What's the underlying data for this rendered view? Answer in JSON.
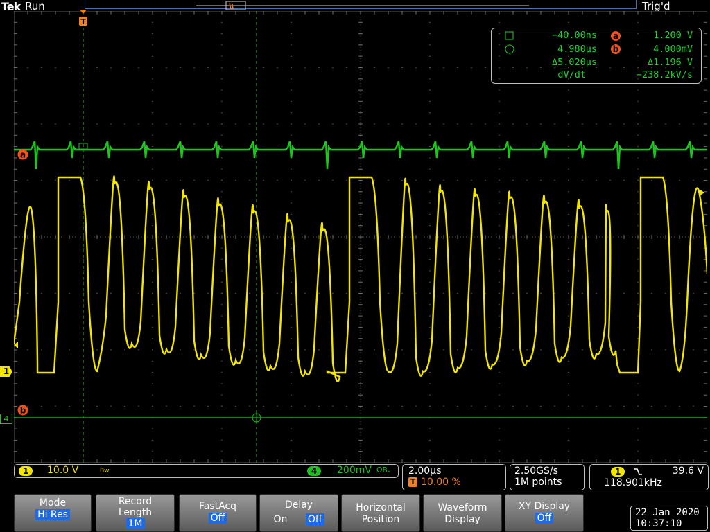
{
  "header": {
    "brand": "Tek",
    "state": "Run",
    "trigger_status": "Trig'd"
  },
  "cursor_readout": {
    "time_a": "−40.00ns",
    "time_b": "4.980µs",
    "delta_t": "Δ5.020µs",
    "dvdt_label": "dV/dt",
    "volt_a": "1.200 V",
    "volt_b": "4.000mV",
    "delta_v": "Δ1.196 V",
    "dvdt_value": "−238.2kV/s",
    "marker_a": "a",
    "marker_b": "b"
  },
  "channel1": {
    "label": "1",
    "scale": "10.0 V",
    "bw": "Bw",
    "color": "#f2e600"
  },
  "channel4": {
    "label": "4",
    "scale": "200mV",
    "coupling": "ΩBᵥ",
    "color": "#20c020"
  },
  "horizontal": {
    "time_per_div": "2.00µs",
    "trigger_pos": "10.00 %",
    "trigger_marker": "T"
  },
  "acquisition": {
    "sample_rate": "2.50GS/s",
    "record": "1M points"
  },
  "trigger": {
    "source": "1",
    "slope_icon": "falling-edge-icon",
    "level": "39.6 V",
    "frequency": "118.901kHz"
  },
  "softkeys": [
    {
      "title": "Mode",
      "value": "Hi Res"
    },
    {
      "title": "Record Length",
      "value": "1M"
    },
    {
      "title": "FastAcq",
      "value": "Off"
    },
    {
      "title": "Delay",
      "opt_on": "On",
      "opt_off": "Off"
    },
    {
      "title": "Horizontal Position",
      "value": ""
    },
    {
      "title": "Waveform Display",
      "value": ""
    },
    {
      "title": "XY Display",
      "value": "Off"
    }
  ],
  "datetime": {
    "date": "22 Jan 2020",
    "time": "10:37:10"
  }
}
